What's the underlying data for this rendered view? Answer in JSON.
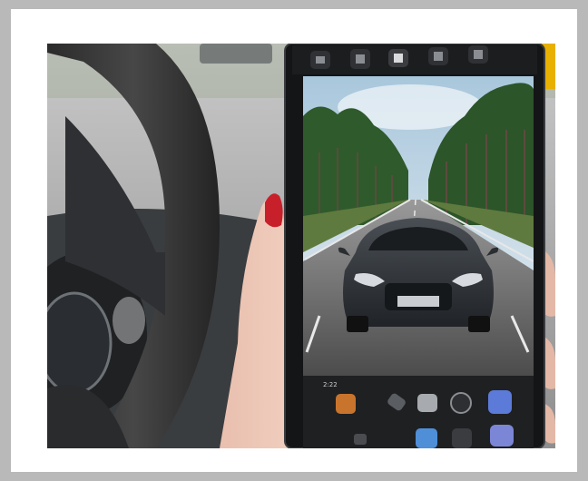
{
  "scene": {
    "description_visible_text": [],
    "phone": {
      "top_bar_icons": [
        "app-icon-1",
        "app-icon-2",
        "app-icon-3",
        "app-icon-4",
        "app-icon-5"
      ],
      "dock_row_1": [
        "app-icon-orange",
        "pen-icon",
        "app-icon-silver",
        "camera-icon",
        "app-icon-blue"
      ],
      "dock_row_2": [
        "app-icon-small",
        "app-icon-blue-2",
        "app-icon-grey",
        "app-icon-purple"
      ],
      "status_label": "2:22"
    },
    "colors": {
      "frame_outer": "#b9b9b9",
      "frame_inner": "#ffffff",
      "nail": "#c8202a",
      "car_body": "#2f3337",
      "sky": "#cfe0ea",
      "trees": "#2f5a2c",
      "phone_body": "#141516"
    }
  }
}
